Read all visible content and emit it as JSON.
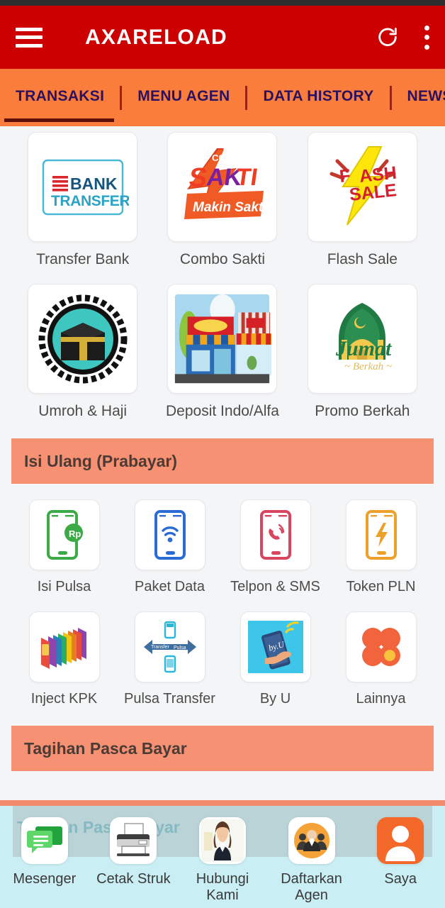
{
  "appbar": {
    "title": "AXARELOAD",
    "menu_icon": "hamburger-menu-icon",
    "refresh_icon": "refresh-icon",
    "overflow_icon": "kebab-menu-icon"
  },
  "tabs": [
    {
      "label": "TRANSAKSI",
      "active": true
    },
    {
      "label": "MENU AGEN",
      "active": false
    },
    {
      "label": "DATA HISTORY",
      "active": false
    },
    {
      "label": "NEWS",
      "active": false
    }
  ],
  "top_grid": [
    {
      "label": "Transfer Bank",
      "icon": "bank-transfer-icon"
    },
    {
      "label": "Combo Sakti",
      "icon": "combo-sakti-icon"
    },
    {
      "label": "Flash Sale",
      "icon": "flash-sale-icon"
    },
    {
      "label": "Umroh & Haji",
      "icon": "kaaba-icon"
    },
    {
      "label": "Deposit Indo/Alfa",
      "icon": "storefront-icon"
    },
    {
      "label": "Promo Berkah",
      "icon": "mosque-jumat-icon"
    }
  ],
  "prepaid_section": {
    "title": "Isi Ulang (Prabayar)",
    "items": [
      {
        "label": "Isi Pulsa",
        "icon": "phone-rupiah-icon"
      },
      {
        "label": "Paket Data",
        "icon": "phone-wifi-icon"
      },
      {
        "label": "Telpon & SMS",
        "icon": "phone-call-icon"
      },
      {
        "label": "Token PLN",
        "icon": "phone-bolt-icon"
      },
      {
        "label": "Inject KPK",
        "icon": "sim-cards-icon"
      },
      {
        "label": "Pulsa Transfer",
        "icon": "transfer-arrows-icon"
      },
      {
        "label": "By U",
        "icon": "byu-hand-phone-icon"
      },
      {
        "label": "Lainnya",
        "icon": "four-dots-icon"
      }
    ]
  },
  "postpaid_section": {
    "title": "Tagihan Pasca Bayar"
  },
  "bottom_nav": [
    {
      "label": "Mesenger",
      "icon": "chat-bubbles-icon"
    },
    {
      "label": "Cetak Struk",
      "icon": "printer-icon"
    },
    {
      "label": "Hubungi Kami",
      "icon": "customer-service-woman-icon"
    },
    {
      "label": "Daftarkan Agen",
      "icon": "people-group-icon"
    },
    {
      "label": "Saya",
      "icon": "person-avatar-icon"
    }
  ],
  "colors": {
    "appbar": "#cc0000",
    "tabbar": "#fa7d3c",
    "tab_text": "#2b1160",
    "section_bar": "#f79174",
    "bottom_nav": "#c9eef3",
    "page_bg": "#f4f5f6"
  }
}
